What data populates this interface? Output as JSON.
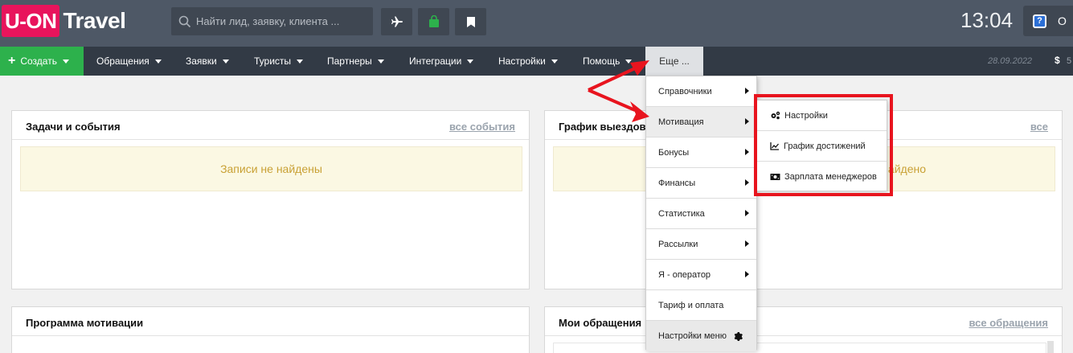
{
  "header": {
    "logo_box": "U-ON",
    "logo_text": "Travel",
    "search_placeholder": "Найти лид, заявку, клиента ...",
    "time": "13:04",
    "user_partial": "O",
    "icons": [
      "plane-icon",
      "bag-icon",
      "bookmark-icon",
      "help-icon"
    ]
  },
  "nav": {
    "create_label": "Создать",
    "items": [
      "Обращения",
      "Заявки",
      "Туристы",
      "Партнеры",
      "Интеграции",
      "Настройки",
      "Помощь"
    ],
    "more_label": "Еще ...",
    "date": "28.09.2022",
    "currency_symbol": "$",
    "currency_partial": "5"
  },
  "panels": {
    "tasks": {
      "title": "Задачи и события",
      "link": "все события",
      "empty": "Записи не найдены"
    },
    "schedule": {
      "title": "График выездов",
      "link": "все",
      "empty": "Записи не найдено"
    },
    "motivation": {
      "title": "Программа мотивации"
    },
    "requests": {
      "title": "Мои обращения",
      "link": "все обращения"
    }
  },
  "dropdown": {
    "items": [
      {
        "label": "Справочники",
        "has_sub": true
      },
      {
        "label": "Мотивация",
        "has_sub": true,
        "active": true
      },
      {
        "label": "Бонусы",
        "has_sub": true
      },
      {
        "label": "Финансы",
        "has_sub": true
      },
      {
        "label": "Статистика",
        "has_sub": true
      },
      {
        "label": "Рассылки",
        "has_sub": true
      },
      {
        "label": "Я - оператор",
        "has_sub": true
      },
      {
        "label": "Тариф и оплата",
        "has_sub": false
      }
    ],
    "menu_settings_label": "Настройки меню"
  },
  "submenu": {
    "items": [
      {
        "label": "Настройки",
        "icon": "cogs-icon"
      },
      {
        "label": "График достижений",
        "icon": "line-chart-icon"
      },
      {
        "label": "Зарплата менеджеров",
        "icon": "money-icon"
      }
    ]
  },
  "colors": {
    "brand": "#e8145c",
    "create": "#2db14c",
    "topbar": "#4e5866",
    "navbar": "#323a45",
    "annotation": "#e8141e"
  }
}
